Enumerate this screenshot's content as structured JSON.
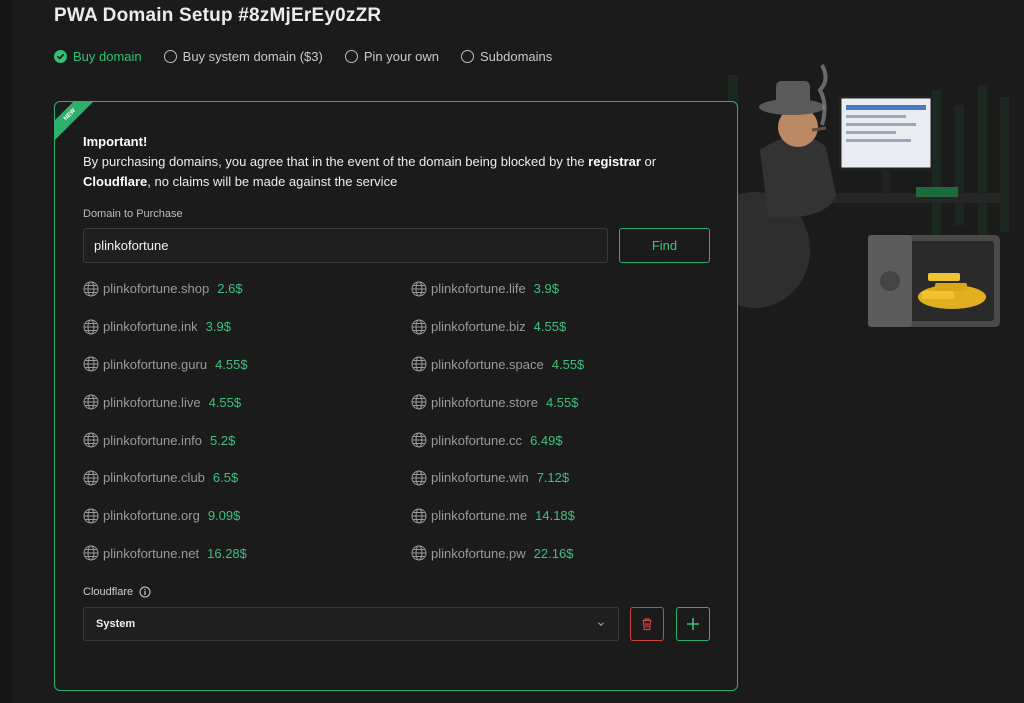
{
  "page": {
    "title": "PWA Domain Setup #8zMjErEy0zZR"
  },
  "options": [
    {
      "label": "Buy domain",
      "selected": true
    },
    {
      "label": "Buy system domain ($3)",
      "selected": false
    },
    {
      "label": "Pin your own",
      "selected": false
    },
    {
      "label": "Subdomains",
      "selected": false
    }
  ],
  "card": {
    "badge": "NEW",
    "notice": {
      "heading": "Important!",
      "text_1": "By purchasing domains, you agree that in the event of the domain being blocked by the ",
      "bold_1": "registrar",
      "text_2": " or",
      "bold_2": "Cloudflare",
      "text_3": ", no claims will be made against the service"
    },
    "domain_label": "Domain to Purchase",
    "domain_value": "plinkofortune",
    "find_label": "Find",
    "results": [
      {
        "name": "plinkofortune.shop",
        "price": "2.6$"
      },
      {
        "name": "plinkofortune.life",
        "price": "3.9$"
      },
      {
        "name": "plinkofortune.ink",
        "price": "3.9$"
      },
      {
        "name": "plinkofortune.biz",
        "price": "4.55$"
      },
      {
        "name": "plinkofortune.guru",
        "price": "4.55$"
      },
      {
        "name": "plinkofortune.space",
        "price": "4.55$"
      },
      {
        "name": "plinkofortune.live",
        "price": "4.55$"
      },
      {
        "name": "plinkofortune.store",
        "price": "4.55$"
      },
      {
        "name": "plinkofortune.info",
        "price": "5.2$"
      },
      {
        "name": "plinkofortune.cc",
        "price": "6.49$"
      },
      {
        "name": "plinkofortune.club",
        "price": "6.5$"
      },
      {
        "name": "plinkofortune.win",
        "price": "7.12$"
      },
      {
        "name": "plinkofortune.org",
        "price": "9.09$"
      },
      {
        "name": "plinkofortune.me",
        "price": "14.18$"
      },
      {
        "name": "plinkofortune.net",
        "price": "16.28$"
      },
      {
        "name": "plinkofortune.pw",
        "price": "22.16$"
      }
    ],
    "cloudflare_label": "Cloudflare",
    "cloudflare_value": "System"
  },
  "icons": {
    "check": "check-circle-icon",
    "radio": "radio-empty-icon",
    "globe": "globe-icon",
    "info": "info-icon",
    "chevron": "chevron-down-icon",
    "trash": "trash-icon",
    "plus": "plus-icon"
  },
  "colors": {
    "accent": "#2fb06a",
    "price": "#3fc07d",
    "danger": "#d14545",
    "background": "#1b1b1c"
  }
}
